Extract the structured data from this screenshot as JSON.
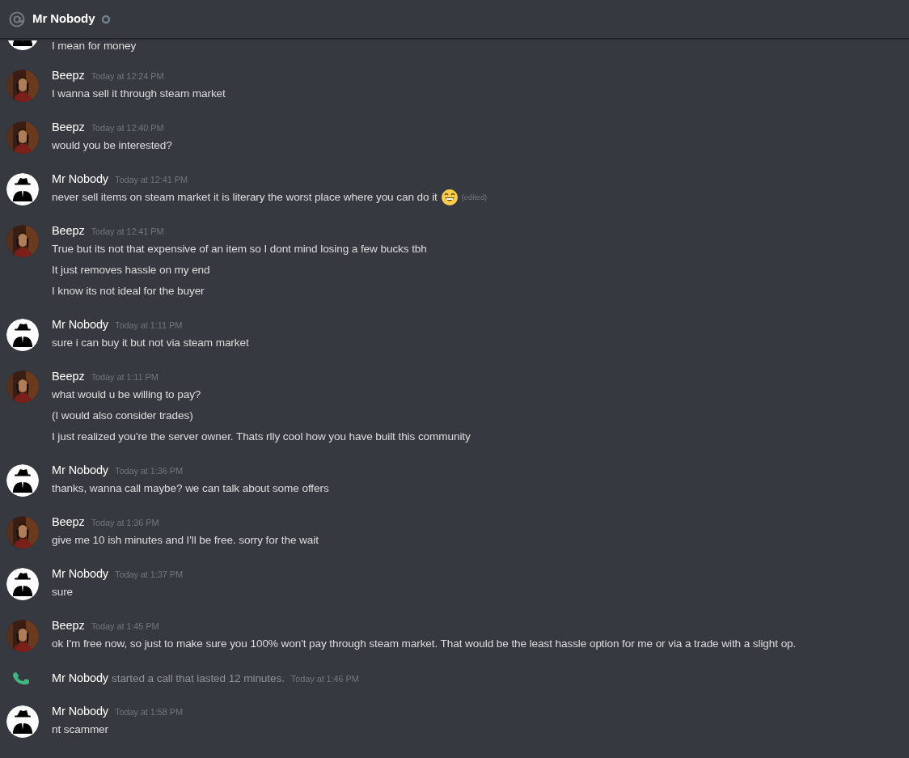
{
  "header": {
    "title": "Mr Nobody"
  },
  "messages": [
    {
      "kind": "continuation",
      "avatar": {
        "kind": "logo"
      },
      "lines": [
        {
          "text": "I mean for money"
        }
      ]
    },
    {
      "kind": "message",
      "author": "Beepz",
      "time": "Today at 12:24 PM",
      "lines": [
        {
          "text": "I wanna sell it through steam market"
        }
      ]
    },
    {
      "kind": "message",
      "author": "Beepz",
      "time": "Today at 12:40 PM",
      "lines": [
        {
          "text": "would you be interested?"
        }
      ]
    },
    {
      "kind": "message",
      "avatar": {
        "kind": "logo"
      },
      "author": "Mr Nobody",
      "time": "Today at 12:41 PM",
      "lines": [
        {
          "text": "never sell items on steam market it is literary the worst place where you can do it",
          "emoji": {
            "kind": "grinning"
          },
          "edited": "(edited)"
        }
      ]
    },
    {
      "kind": "message",
      "author": "Beepz",
      "time": "Today at 12:41 PM",
      "lines": [
        {
          "text": "True but its not that expensive of an item so I dont mind losing a few bucks tbh"
        },
        {
          "text": "It just removes hassle on my end"
        },
        {
          "text": "I know its not ideal for the buyer"
        }
      ]
    },
    {
      "kind": "message",
      "avatar": {
        "kind": "logo"
      },
      "author": "Mr Nobody",
      "time": "Today at 1:11 PM",
      "lines": [
        {
          "text": "sure i can buy it but not via steam market"
        }
      ]
    },
    {
      "kind": "message",
      "author": "Beepz",
      "time": "Today at 1:11 PM",
      "lines": [
        {
          "text": "what would u be willing to pay?"
        },
        {
          "text": "(I would also consider trades)"
        },
        {
          "text": "I just realized you're the server owner. Thats rlly cool how you have built this community"
        }
      ]
    },
    {
      "kind": "message",
      "avatar": {
        "kind": "logo"
      },
      "author": "Mr Nobody",
      "time": "Today at 1:36 PM",
      "lines": [
        {
          "text": "thanks, wanna call maybe? we can talk about some offers"
        }
      ]
    },
    {
      "kind": "message",
      "author": "Beepz",
      "time": "Today at 1:36 PM",
      "lines": [
        {
          "text": "give me 10 ish minutes and I'll be free. sorry for the wait"
        }
      ]
    },
    {
      "kind": "message",
      "avatar": {
        "kind": "logo"
      },
      "author": "Mr Nobody",
      "time": "Today at 1:37 PM",
      "lines": [
        {
          "text": "sure"
        }
      ]
    },
    {
      "kind": "message",
      "author": "Beepz",
      "time": "Today at 1:45 PM",
      "lines": [
        {
          "text": "ok I'm free now, so just to make sure you 100% won't pay through steam market. That would be the least hassle option for me or via a trade with a slight op."
        }
      ]
    },
    {
      "kind": "call",
      "author": "Mr Nobody",
      "text": "started a call that lasted 12 minutes.",
      "time": "Today at 1:46 PM"
    },
    {
      "kind": "message",
      "avatar": {
        "kind": "logo"
      },
      "author": "Mr Nobody",
      "time": "Today at 1:58 PM",
      "lines": [
        {
          "text": "nt scammer"
        }
      ]
    }
  ]
}
